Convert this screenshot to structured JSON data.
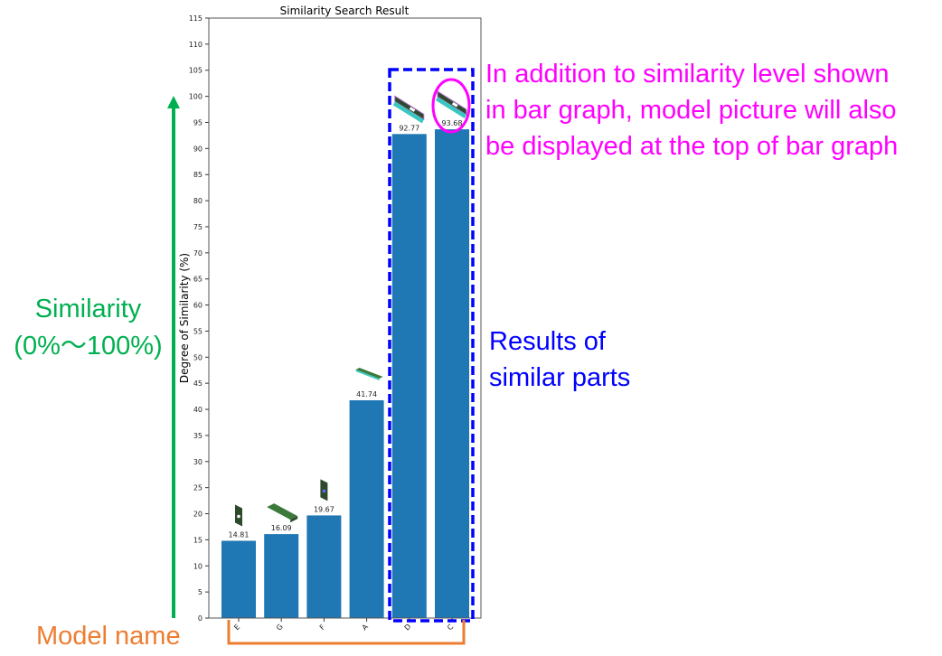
{
  "chart_data": {
    "type": "bar",
    "title": "Similarity Search Result",
    "xlabel": "",
    "ylabel": "Degree of Similarity (%)",
    "categories": [
      "E",
      "G",
      "F",
      "A",
      "D",
      "C"
    ],
    "values": [
      14.81,
      16.09,
      19.67,
      41.74,
      92.77,
      93.68
    ],
    "data_labels": [
      "14.81",
      "16.09",
      "19.67",
      "41.74",
      "92.77",
      "93.68"
    ],
    "ylim": [
      0,
      115
    ],
    "yticks": [
      0,
      5,
      10,
      15,
      20,
      25,
      30,
      35,
      40,
      45,
      50,
      55,
      60,
      65,
      70,
      75,
      80,
      85,
      90,
      95,
      100,
      105,
      110,
      115
    ],
    "grid": false,
    "bar_color": "#1f77b4",
    "thumbnails": "model picture above each bar"
  },
  "annotations": {
    "similarity": [
      "Similarity",
      "(0%～100%)"
    ],
    "model_name": "Model name",
    "description": [
      "In addition to similarity level shown",
      "in bar graph, model picture will also",
      "be displayed at the top of bar graph"
    ],
    "results": [
      "Results of",
      "similar parts"
    ],
    "colors": {
      "similarity": "#00b050",
      "model_name": "#ed7d31",
      "description": "#ff00ff",
      "results": "#0000ff"
    }
  }
}
